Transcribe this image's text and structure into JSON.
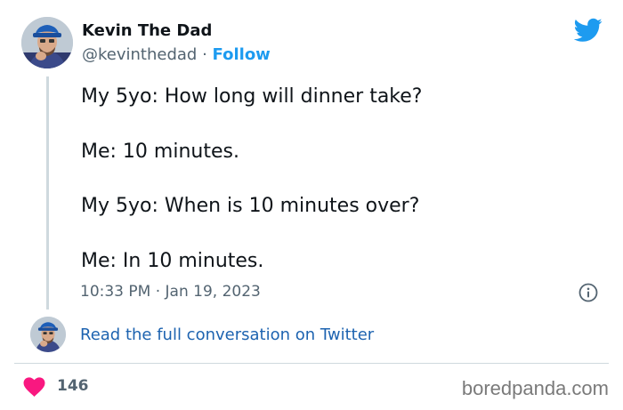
{
  "author": {
    "name": "Kevin The Dad",
    "handle": "@kevinthedad",
    "separator": "·",
    "follow_label": "Follow"
  },
  "tweet": {
    "lines": [
      "My 5yo: How long will dinner take?",
      "Me: 10 minutes.",
      "My 5yo: When is 10 minutes over?",
      "Me: In 10 minutes."
    ],
    "timestamp": "10:33 PM · Jan 19, 2023"
  },
  "conversation_link": "Read the full conversation on Twitter",
  "footer": {
    "like_count": "146",
    "watermark": "boredpanda.com"
  },
  "icons": {
    "brand": "twitter-bird-icon",
    "info": "info-icon",
    "like": "heart-icon"
  },
  "colors": {
    "twitter_blue": "#1d9bf0",
    "like_pink": "#f91880",
    "link_blue": "#1d63b0",
    "secondary_text": "#536471"
  }
}
